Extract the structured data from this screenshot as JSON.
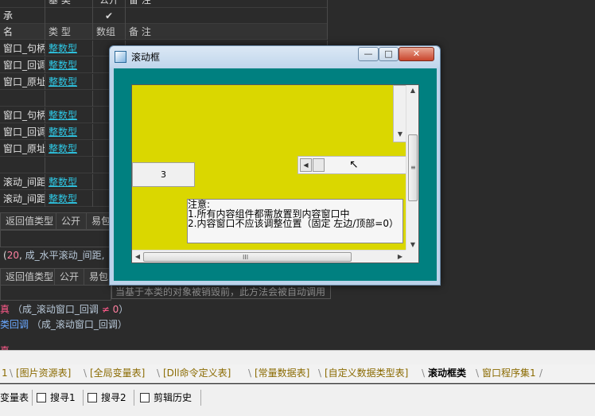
{
  "ide": {
    "top_row": {
      "c1": "基 类",
      "c2": "公开",
      "c3": "备 注",
      "check": "✔"
    },
    "header": {
      "c0": "名",
      "c1": "类 型",
      "c2": "数组",
      "c3": "备 注"
    },
    "rows": [
      {
        "name": "窗口_句柄",
        "type": "整数型"
      },
      {
        "name": "窗口_回调",
        "type": "整数型"
      },
      {
        "name": "窗口_原址",
        "type": "整数型"
      },
      {
        "name": "",
        "type": ""
      },
      {
        "name": "窗口_句柄",
        "type": "整数型"
      },
      {
        "name": "窗口_回调",
        "type": "整数型"
      },
      {
        "name": "窗口_原址",
        "type": "整数型"
      },
      {
        "name": "",
        "type": ""
      },
      {
        "name": "滚动_间距",
        "type": "整数型"
      },
      {
        "name": "滚动_间距",
        "type": "整数型"
      }
    ],
    "ret_header_1": {
      "a": "返回值类型",
      "b": "公开",
      "c": "易包"
    },
    "code_line_1": {
      "num": "20",
      "rest": "成_水平滚动_间距,"
    },
    "ret_header_2": {
      "a": "返回值类型",
      "b": "公开",
      "c": "易包"
    },
    "comment": "当基于本类的对象被销毁前，此方法会被自动调用",
    "code_line_2": {
      "kw": "真",
      "paren_open": "（成_滚动窗口_回调",
      "op": "≠",
      "num": "0",
      "paren_close": "）"
    },
    "code_line_3": {
      "kw": "类回调",
      "rest": "（成_滚动窗口_回调）"
    }
  },
  "tabs": [
    {
      "label": "1"
    },
    {
      "label": "[图片资源表]"
    },
    {
      "label": "[全局变量表]"
    },
    {
      "label": "[Dll命令定义表]"
    },
    {
      "label": "[常量数据表]"
    },
    {
      "label": "[自定义数据类型表]"
    },
    {
      "label": "滚动框类",
      "active": true
    },
    {
      "label": "窗口程序集1"
    }
  ],
  "toolbar": {
    "items": [
      {
        "label": "变量表"
      },
      {
        "label": "搜寻1"
      },
      {
        "label": "搜寻2"
      },
      {
        "label": "剪辑历史"
      }
    ]
  },
  "dialog": {
    "title": "滚动框",
    "min": "—",
    "max": "□",
    "close": "✕",
    "inner_button": "3",
    "note_lines": [
      "注意:",
      "1.所有内容组件都需放置到内容窗口中",
      "2.内容窗口不应该调整位置（固定 左边/顶部=0）"
    ],
    "hscroll_grip": "III",
    "vscroll_grip": "≡"
  }
}
